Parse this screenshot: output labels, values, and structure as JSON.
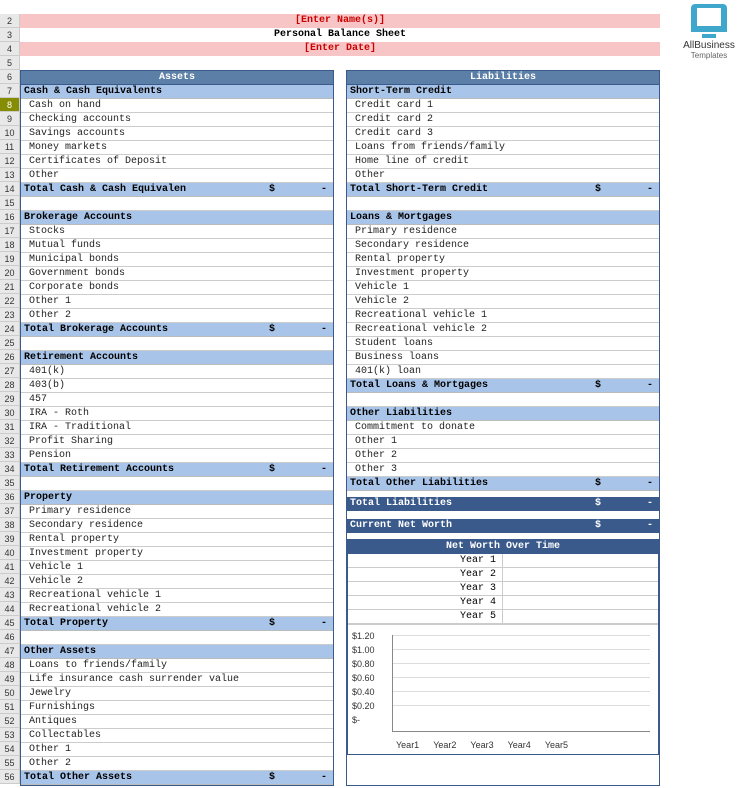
{
  "header": {
    "name_placeholder": "[Enter Name(s)]",
    "title": "Personal Balance Sheet",
    "date_placeholder": "[Enter Date]"
  },
  "logo": {
    "line1": "AllBusiness",
    "line2": "Templates"
  },
  "assets": {
    "heading": "Assets",
    "sections": [
      {
        "name": "Cash & Cash Equivalents",
        "items": [
          "Cash on hand",
          "Checking accounts",
          "Savings accounts",
          "Money markets",
          "Certificates of Deposit",
          "Other"
        ],
        "total_label": "Total Cash & Cash Equivalen",
        "currency": "$",
        "total_value": "-"
      },
      {
        "name": "Brokerage Accounts",
        "items": [
          "Stocks",
          "Mutual funds",
          "Municipal bonds",
          "Government bonds",
          "Corporate bonds",
          "Other 1",
          "Other 2"
        ],
        "total_label": "Total Brokerage Accounts",
        "currency": "$",
        "total_value": "-"
      },
      {
        "name": "Retirement Accounts",
        "items": [
          "401(k)",
          "403(b)",
          "457",
          "IRA - Roth",
          "IRA - Traditional",
          "Profit Sharing",
          "Pension"
        ],
        "total_label": "Total Retirement Accounts",
        "currency": "$",
        "total_value": "-"
      },
      {
        "name": "Property",
        "items": [
          "Primary  residence",
          "Secondary residence",
          "Rental property",
          "Investment property",
          "Vehicle 1",
          "Vehicle 2",
          "Recreational vehicle 1",
          "Recreational vehicle 2"
        ],
        "total_label": "Total Property",
        "currency": "$",
        "total_value": "-"
      },
      {
        "name": "Other Assets",
        "items": [
          "Loans to friends/family",
          "Life insurance cash surrender value",
          "Jewelry",
          "Furnishings",
          "Antiques",
          "Collectables",
          "Other 1",
          "Other 2"
        ],
        "total_label": "Total Other Assets",
        "currency": "$",
        "total_value": "-"
      }
    ]
  },
  "liabilities": {
    "heading": "Liabilities",
    "sections": [
      {
        "name": "Short-Term Credit",
        "items": [
          "Credit card 1",
          "Credit card 2",
          "Credit card 3",
          "Loans from friends/family",
          "Home line of credit",
          "Other"
        ],
        "total_label": "Total Short-Term Credit",
        "currency": "$",
        "total_value": "-"
      },
      {
        "name": "Loans & Mortgages",
        "items": [
          "Primary  residence",
          "Secondary residence",
          "Rental property",
          "Investment property",
          "Vehicle 1",
          "Vehicle 2",
          "Recreational vehicle 1",
          "Recreational vehicle 2",
          "Student loans",
          "Business loans",
          "401(k) loan"
        ],
        "total_label": "Total Loans & Mortgages",
        "currency": "$",
        "total_value": "-"
      },
      {
        "name": "Other Liabilities",
        "items": [
          "Commitment to donate",
          "Other 1",
          "Other 2",
          "Other 3"
        ],
        "total_label": "Total Other Liabilities",
        "currency": "$",
        "total_value": "-"
      }
    ],
    "grand_total": {
      "label": "Total Liabilities",
      "currency": "$",
      "value": "-"
    }
  },
  "networth": {
    "current_label": "Current Net Worth",
    "currency": "$",
    "value": "-",
    "overtime_heading": "Net Worth Over Time",
    "rows": [
      "Year 1",
      "Year 2",
      "Year 3",
      "Year 4",
      "Year 5"
    ]
  },
  "row_numbers": [
    2,
    3,
    4,
    5,
    6,
    7,
    8,
    9,
    10,
    11,
    12,
    13,
    14,
    15,
    16,
    17,
    18,
    19,
    20,
    21,
    22,
    23,
    24,
    25,
    26,
    27,
    28,
    29,
    30,
    31,
    32,
    33,
    34,
    35,
    36,
    37,
    38,
    39,
    40,
    41,
    42,
    43,
    44,
    45,
    46,
    47,
    48,
    49,
    50,
    51,
    52,
    53,
    54,
    55,
    56
  ],
  "selected_row": 8,
  "chart_data": {
    "type": "bar",
    "categories": [
      "Year1",
      "Year2",
      "Year3",
      "Year4",
      "Year5"
    ],
    "values": [
      0,
      0,
      0,
      0,
      0
    ],
    "title": "",
    "xlabel": "",
    "ylabel": "",
    "ylim": [
      0,
      1.2
    ],
    "yticks": [
      "$1.20",
      "$1.00",
      "$0.80",
      "$0.60",
      "$0.40",
      "$0.20",
      "$-"
    ]
  }
}
